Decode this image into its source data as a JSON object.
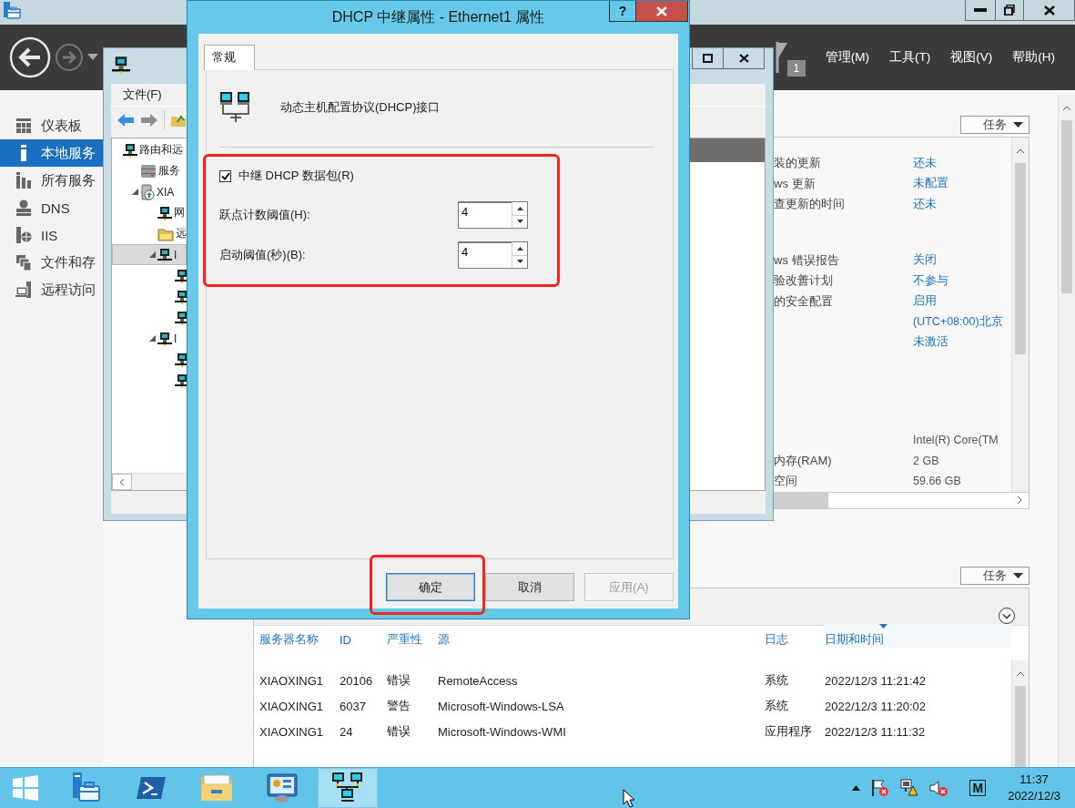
{
  "server_manager": {
    "notification_count": "1",
    "menu": [
      "管理(M)",
      "工具(T)",
      "视图(V)",
      "帮助(H)"
    ],
    "sidebar": [
      {
        "label": "仪表板",
        "kind": "dashboard",
        "selected": false
      },
      {
        "label": "本地服务",
        "kind": "local",
        "selected": true
      },
      {
        "label": "所有服务",
        "kind": "all",
        "selected": false
      },
      {
        "label": "DNS",
        "kind": "dns",
        "selected": false
      },
      {
        "label": "IIS",
        "kind": "iis",
        "selected": false
      },
      {
        "label": "文件和存",
        "kind": "files",
        "selected": false
      },
      {
        "label": "远程访问",
        "kind": "remote",
        "selected": false
      }
    ],
    "properties": {
      "tasks_button": "任务",
      "groups": [
        [
          {
            "label": "装的更新",
            "value": "还未",
            "kind": "link"
          },
          {
            "label": "ws 更新",
            "value": "未配置",
            "kind": "link"
          },
          {
            "label": "查更新的时间",
            "value": "还未",
            "kind": "link"
          }
        ],
        [
          {
            "label": "ws 错误报告",
            "value": "关闭",
            "kind": "link"
          },
          {
            "label": "验改善计划",
            "value": "不参与",
            "kind": "link"
          },
          {
            "label": "的安全配置",
            "value": "启用",
            "kind": "link"
          },
          {
            "value": "(UTC+08:00)北京",
            "kind": "link"
          },
          {
            "value": "未激活",
            "kind": "link"
          }
        ],
        [
          {
            "value": "Intel(R) Core(TM",
            "kind": "text"
          },
          {
            "label": "内存(RAM)",
            "value": "2 GB",
            "kind": "text"
          },
          {
            "label": "空间",
            "value": "59.66 GB",
            "kind": "text"
          }
        ]
      ]
    },
    "events": {
      "tasks_button": "任务",
      "columns": [
        {
          "label": "服务器名称",
          "sorted": false
        },
        {
          "label": "ID",
          "sorted": false
        },
        {
          "label": "严重性",
          "sorted": false
        },
        {
          "label": "源",
          "sorted": false
        },
        {
          "label": "日志",
          "sorted": false
        },
        {
          "label": "日期和时间",
          "sorted": true
        }
      ],
      "rows": [
        [
          "XIAOXING1",
          "20106",
          "错误",
          "RemoteAccess",
          "系统",
          "2022/12/3 11:21:42"
        ],
        [
          "XIAOXING1",
          "6037",
          "警告",
          "Microsoft-Windows-LSA",
          "系统",
          "2022/12/3 11:20:02"
        ],
        [
          "XIAOXING1",
          "24",
          "错误",
          "Microsoft-Windows-WMI",
          "应用程序",
          "2022/12/3 11:11:32"
        ]
      ]
    }
  },
  "rras_window": {
    "menu": [
      "文件(F)"
    ],
    "tree": [
      {
        "label": "路由和远",
        "kind": "router",
        "selected": false,
        "children": [
          {
            "label": "服务",
            "kind": "servers",
            "selected": false
          },
          {
            "label": "XIA",
            "kind": "server",
            "expanded": true,
            "selected": false,
            "children": [
              {
                "label": "网",
                "kind": "router",
                "selected": false
              },
              {
                "label": "远",
                "kind": "folder",
                "selected": false
              },
              {
                "label": "I",
                "kind": "router",
                "expanded": true,
                "selected": true,
                "children": [
                  {
                    "kind": "router",
                    "selected": false
                  },
                  {
                    "kind": "router",
                    "selected": false
                  },
                  {
                    "kind": "router",
                    "selected": false
                  }
                ]
              },
              {
                "label": "I",
                "kind": "router",
                "expanded": true,
                "selected": false,
                "children": [
                  {
                    "kind": "router",
                    "selected": false
                  },
                  {
                    "kind": "router",
                    "selected": false
                  }
                ]
              }
            ]
          }
        ]
      }
    ]
  },
  "dialog": {
    "title": "DHCP 中继属性 - Ethernet1 属性",
    "help_button": "?",
    "tabs": [
      {
        "label": "常规",
        "selected": true
      }
    ],
    "description": "动态主机配置协议(DHCP)接口",
    "relay_checkbox": {
      "label": "中继 DHCP 数据包(R)",
      "checked": true
    },
    "fields": [
      {
        "label": "跃点计数阈值(H):",
        "value": "4"
      },
      {
        "label": "启动阈值(秒)(B):",
        "value": "4"
      }
    ],
    "buttons": [
      {
        "label": "确定",
        "kind": "default",
        "disabled": false
      },
      {
        "label": "取消",
        "kind": "normal",
        "disabled": false
      },
      {
        "label": "应用(A)",
        "kind": "normal",
        "disabled": true
      }
    ]
  },
  "taskbar": {
    "apps": [
      {
        "kind": "server-manager",
        "selected": false
      },
      {
        "kind": "powershell",
        "selected": false
      },
      {
        "kind": "explorer",
        "selected": false
      },
      {
        "kind": "control-panel",
        "selected": false
      },
      {
        "kind": "network",
        "selected": true
      }
    ],
    "ime": "M",
    "time": "11:37",
    "date": "2022/12/3"
  }
}
